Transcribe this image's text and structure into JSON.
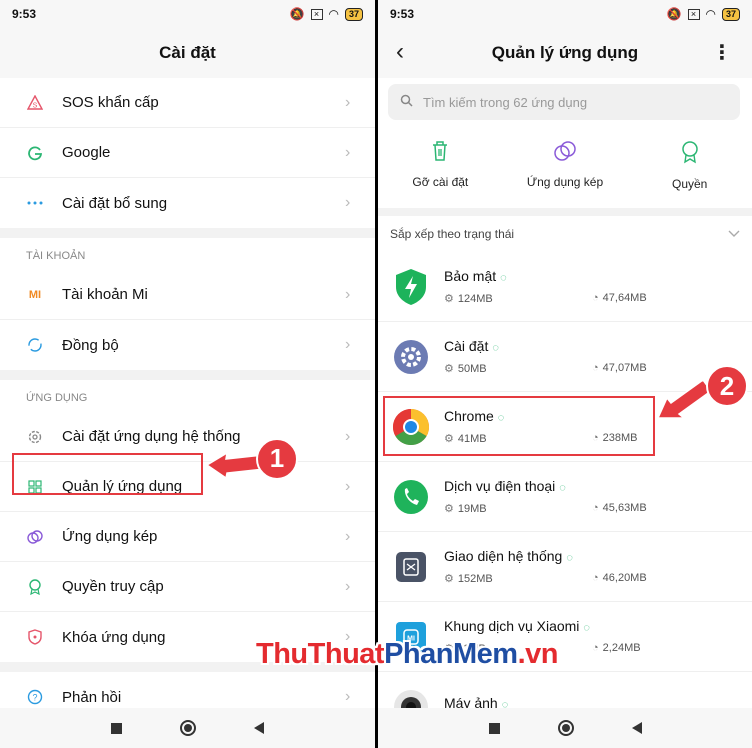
{
  "left": {
    "status_time": "9:53",
    "battery": "37",
    "title": "Cài đặt",
    "items_top": [
      {
        "label": "SOS khẩn cấp",
        "icon": "warning-icon"
      },
      {
        "label": "Google",
        "icon": "google-icon"
      },
      {
        "label": "Cài đặt bổ sung",
        "icon": "more-dots-icon"
      }
    ],
    "section_account": "TÀI KHOẢN",
    "items_account": [
      {
        "label": "Tài khoản Mi",
        "icon": "mi-icon"
      },
      {
        "label": "Đồng bộ",
        "icon": "sync-icon"
      }
    ],
    "section_apps": "ỨNG DỤNG",
    "items_apps": [
      {
        "label": "Cài đặt ứng dụng hệ thống",
        "icon": "gear-icon"
      },
      {
        "label": "Quản lý ứng dụng",
        "icon": "grid-icon"
      },
      {
        "label": "Ứng dụng kép",
        "icon": "dual-app-icon"
      },
      {
        "label": "Quyền truy cập",
        "icon": "permission-icon"
      },
      {
        "label": "Khóa ứng dụng",
        "icon": "shield-lock-icon"
      }
    ],
    "feedback": {
      "label": "Phản hồi",
      "icon": "help-icon"
    },
    "mi_text": "MI",
    "callout_number": "1"
  },
  "right": {
    "status_time": "9:53",
    "battery": "37",
    "title": "Quản lý ứng dụng",
    "search_placeholder": "Tìm kiếm trong 62 ứng dụng",
    "actions": [
      {
        "label": "Gỡ cài đặt",
        "icon": "trash-icon"
      },
      {
        "label": "Ứng dụng kép",
        "icon": "dual-app-icon"
      },
      {
        "label": "Quyền",
        "icon": "badge-icon"
      }
    ],
    "sort_label": "Sắp xếp theo trạng thái",
    "apps": [
      {
        "name": "Bảo mật",
        "size": "124MB",
        "storage": "47,64MB",
        "icon": "security-shield-icon",
        "color": "#1db35b"
      },
      {
        "name": "Cài đặt",
        "size": "50MB",
        "storage": "47,07MB",
        "icon": "settings-gear-icon",
        "color": "#6c7bb3"
      },
      {
        "name": "Chrome",
        "size": "41MB",
        "storage": "238MB",
        "icon": "chrome-icon",
        "color": "#4285f4"
      },
      {
        "name": "Dịch vụ điện thoại",
        "size": "19MB",
        "storage": "45,63MB",
        "icon": "phone-icon",
        "color": "#1fb35b"
      },
      {
        "name": "Giao diện hệ thống",
        "size": "152MB",
        "storage": "46,20MB",
        "icon": "system-ui-icon",
        "color": "#4a5366"
      },
      {
        "name": "Khung dịch vụ Xiaomi",
        "size": "11MB",
        "storage": "2,24MB",
        "icon": "xiaomi-framework-icon",
        "color": "#1ea0dc"
      },
      {
        "name": "Máy ảnh",
        "size": "",
        "storage": "",
        "icon": "camera-icon",
        "color": "#333333"
      }
    ],
    "callout_number": "2"
  },
  "watermark": {
    "part1": "ThuThuat",
    "part2": "PhanMem",
    "part3": ".vn"
  },
  "colors": {
    "highlight": "#e53a40",
    "accent_green": "#2bb673"
  }
}
